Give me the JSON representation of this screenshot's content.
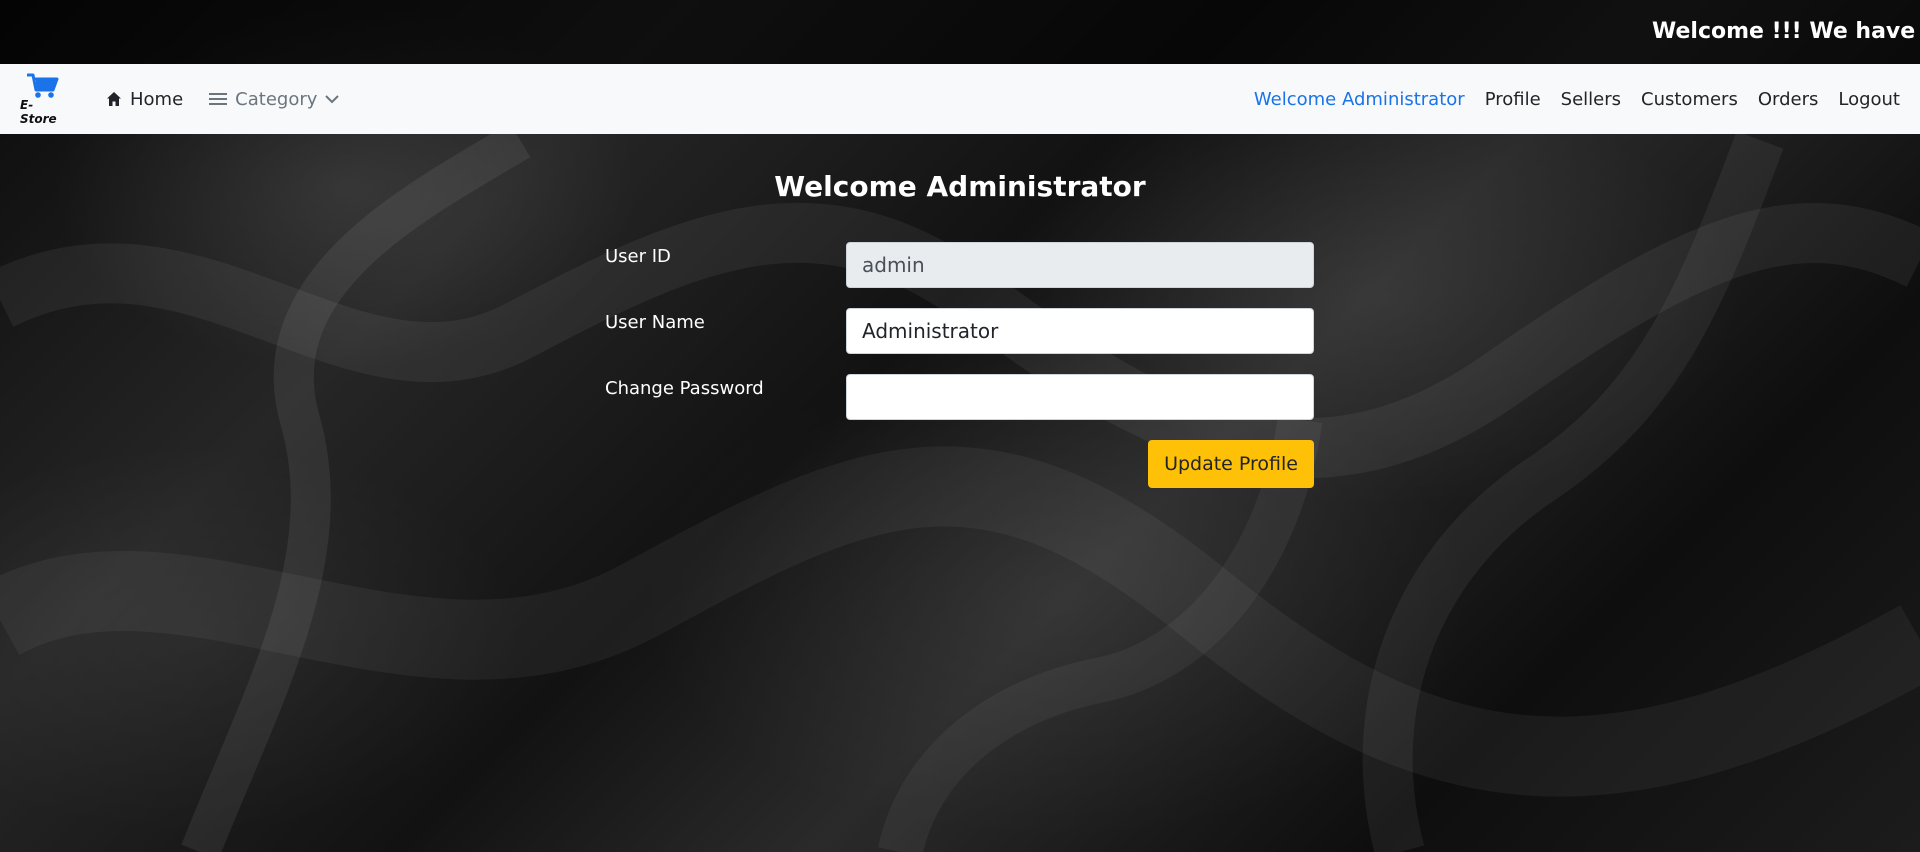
{
  "marquee": {
    "text": "Welcome !!! We have a G"
  },
  "navbar": {
    "brand": {
      "text": "E-Store",
      "icon": "cart-icon",
      "icon_color": "#1a73e8"
    },
    "left": {
      "home": {
        "label": "Home",
        "icon": "home-icon"
      },
      "category": {
        "label": "Category",
        "icon": "menu-icon",
        "caret": "chevron-down-icon"
      }
    },
    "right": {
      "welcome": "Welcome Administrator",
      "profile": "Profile",
      "sellers": "Sellers",
      "customers": "Customers",
      "orders": "Orders",
      "logout": "Logout"
    },
    "active_color": "#1a73e8"
  },
  "main": {
    "title": "Welcome Administrator",
    "form": {
      "user_id": {
        "label": "User ID",
        "value": "admin"
      },
      "user_name": {
        "label": "User Name",
        "value": "Administrator"
      },
      "change_password": {
        "label": "Change Password",
        "value": ""
      },
      "submit_label": "Update Profile",
      "submit_color": "#ffc107"
    }
  }
}
